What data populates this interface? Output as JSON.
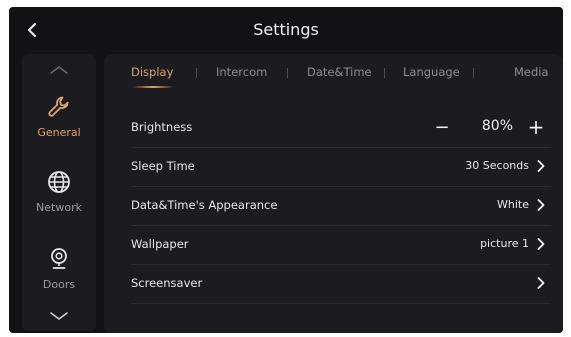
{
  "header": {
    "title": "Settings",
    "back_icon": "chevron-left-icon"
  },
  "sidebar": {
    "items": [
      {
        "label": "General",
        "icon": "wrench-icon",
        "active": true
      },
      {
        "label": "Network",
        "icon": "globe-icon",
        "active": false
      },
      {
        "label": "Doors",
        "icon": "doorbell-camera-icon",
        "active": false
      }
    ],
    "scroll_up_icon": "chevron-up-icon",
    "scroll_down_icon": "chevron-down-icon"
  },
  "tabs": [
    {
      "label": "Display",
      "active": true
    },
    {
      "label": "Intercom",
      "active": false
    },
    {
      "label": "Date&Time",
      "active": false
    },
    {
      "label": "Language",
      "active": false
    },
    {
      "label": "Media",
      "active": false
    }
  ],
  "settings": {
    "brightness": {
      "label": "Brightness",
      "value": "80%",
      "minus": "−",
      "plus": "+"
    },
    "sleep_time": {
      "label": "Sleep Time",
      "value": "30 Seconds"
    },
    "datetime_appearance": {
      "label": "Data&Time's Appearance",
      "value": "White"
    },
    "wallpaper": {
      "label": "Wallpaper",
      "value": "picture 1"
    },
    "screensaver": {
      "label": "Screensaver",
      "value": ""
    }
  },
  "colors": {
    "accent": "#d8a66e",
    "background": "#121214",
    "panel": "#1c1c20",
    "text": "#e8e8ea",
    "muted": "#8e8e94"
  }
}
